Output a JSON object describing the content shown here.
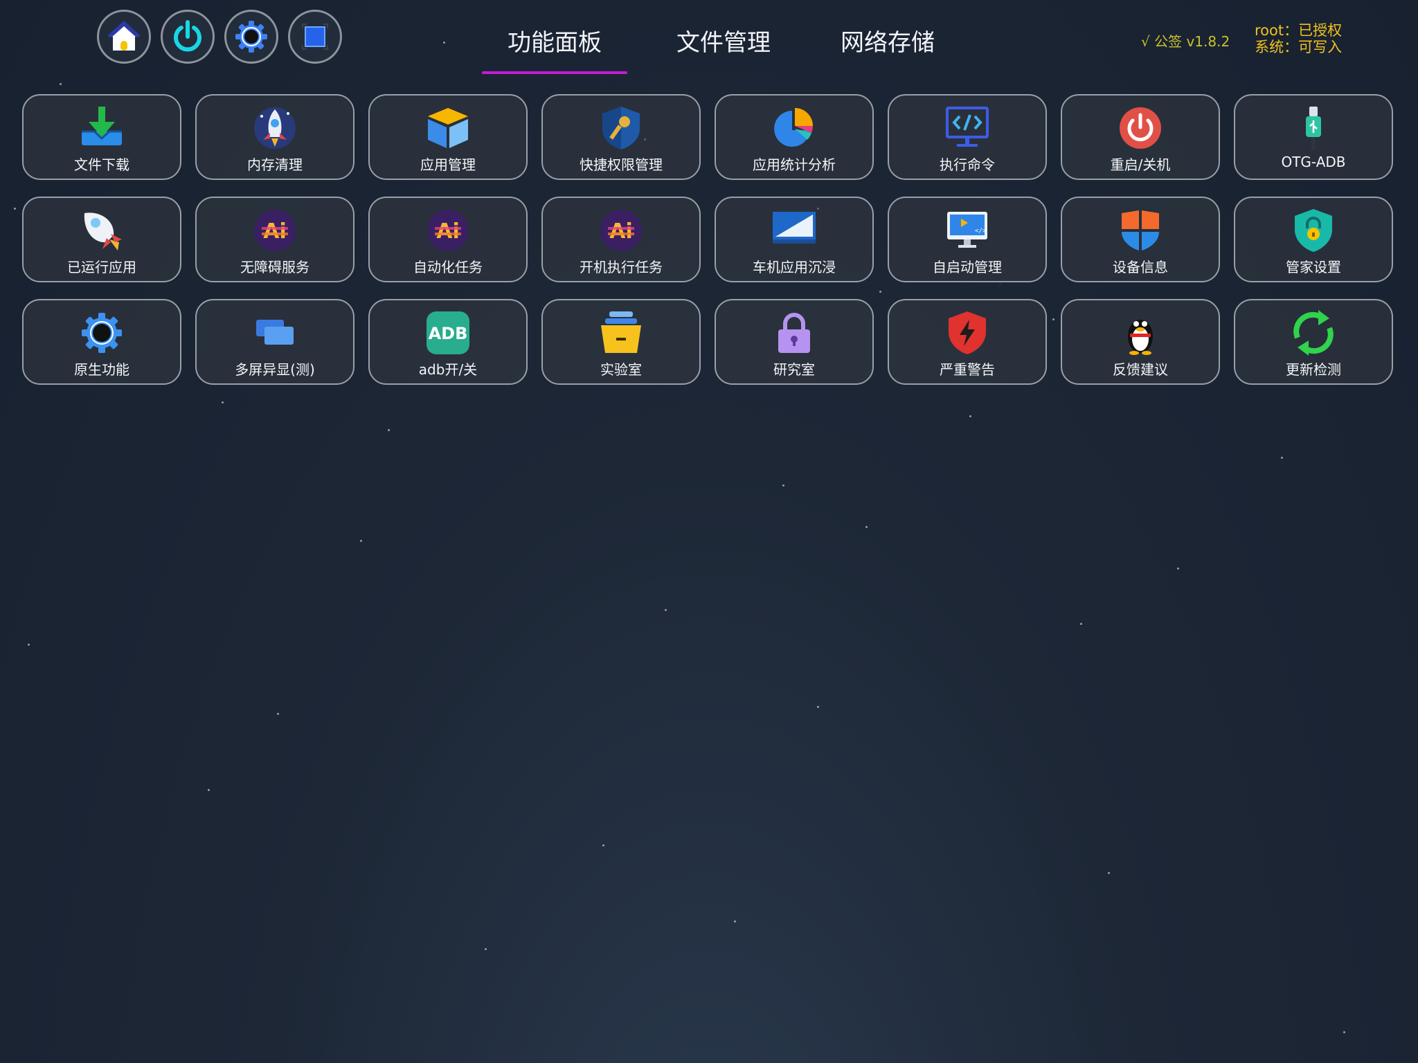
{
  "top_buttons": [
    {
      "icon": "home-icon"
    },
    {
      "icon": "power-icon"
    },
    {
      "icon": "gear-icon"
    },
    {
      "icon": "screen-icon"
    }
  ],
  "tabs": [
    {
      "label": "功能面板",
      "active": true
    },
    {
      "label": "文件管理",
      "active": false
    },
    {
      "label": "网络存储",
      "active": false
    }
  ],
  "version": "√ 公签 v1.8.2",
  "status": {
    "root": "root：已授权",
    "system": "系统：可写入"
  },
  "tiles": [
    {
      "label": "文件下载",
      "icon": "download-icon"
    },
    {
      "label": "内存清理",
      "icon": "rocket-clean-icon"
    },
    {
      "label": "应用管理",
      "icon": "box-icon"
    },
    {
      "label": "快捷权限管理",
      "icon": "shield-key-icon"
    },
    {
      "label": "应用统计分析",
      "icon": "pie-chart-icon"
    },
    {
      "label": "执行命令",
      "icon": "code-monitor-icon"
    },
    {
      "label": "重启/关机",
      "icon": "power-red-icon"
    },
    {
      "label": "OTG-ADB",
      "icon": "usb-icon"
    },
    {
      "label": "已运行应用",
      "icon": "rocket-icon"
    },
    {
      "label": "无障碍服务",
      "icon": "ai-icon"
    },
    {
      "label": "自动化任务",
      "icon": "ai-icon"
    },
    {
      "label": "开机执行任务",
      "icon": "ai-icon"
    },
    {
      "label": "车机应用沉浸",
      "icon": "display-icon"
    },
    {
      "label": "自启动管理",
      "icon": "monitor-play-icon"
    },
    {
      "label": "设备信息",
      "icon": "windows-shield-icon"
    },
    {
      "label": "管家设置",
      "icon": "shield-lock-icon"
    },
    {
      "label": "原生功能",
      "icon": "gear-blue-icon"
    },
    {
      "label": "多屏异显(测)",
      "icon": "multi-screen-icon"
    },
    {
      "label": "adb开/关",
      "icon": "adb-icon"
    },
    {
      "label": "实验室",
      "icon": "drawer-icon"
    },
    {
      "label": "研究室",
      "icon": "padlock-icon"
    },
    {
      "label": "严重警告",
      "icon": "warning-shield-icon"
    },
    {
      "label": "反馈建议",
      "icon": "penguin-icon"
    },
    {
      "label": "更新检测",
      "icon": "refresh-icon"
    }
  ],
  "colors": {
    "tab_indicator": "#c41bd9",
    "version": "#c7c22e",
    "status": "#f2c21d"
  }
}
